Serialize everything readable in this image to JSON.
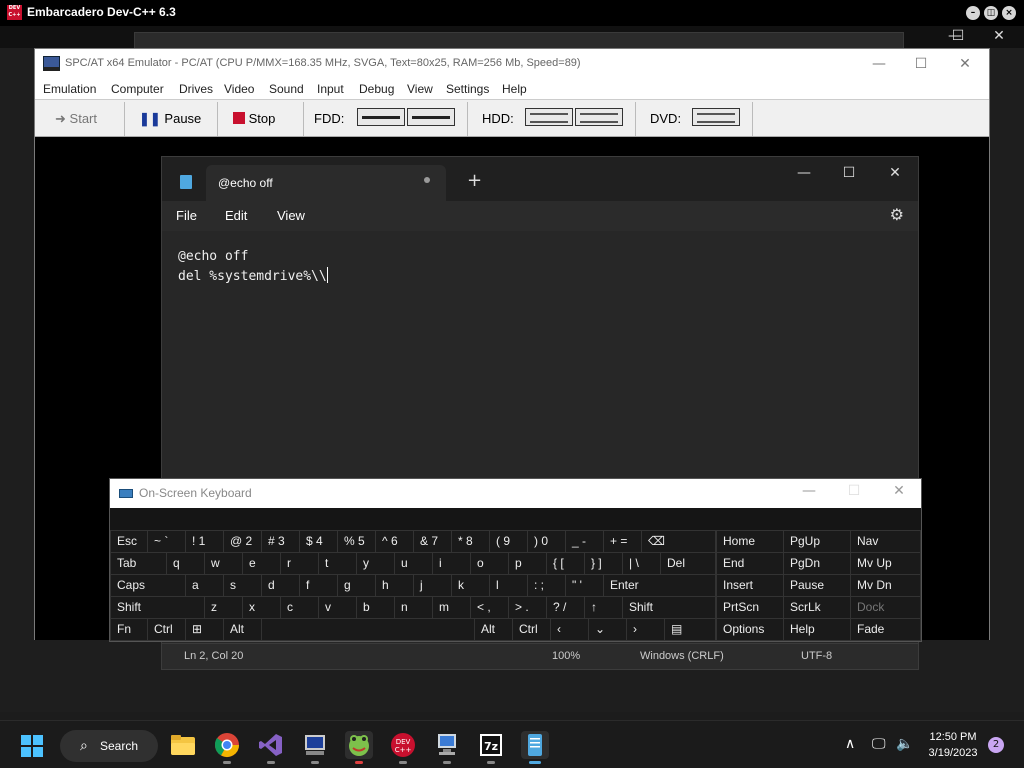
{
  "devcpp": {
    "title": "Embarcadero Dev-C++ 6.3",
    "logo_text": "DEV C++"
  },
  "emulator": {
    "title": "SPC/AT x64 Emulator - PC/AT (CPU P/MMX=168.35 MHz, SVGA, Text=80x25, RAM=256 Mb, Speed=89)",
    "menu": [
      "Emulation",
      "Computer",
      "Drives",
      "Video",
      "Sound",
      "Input",
      "Debug",
      "View",
      "Settings",
      "Help"
    ],
    "toolbar": {
      "start": "Start",
      "pause": "Pause",
      "stop": "Stop",
      "fdd": "FDD:",
      "hdd": "HDD:",
      "dvd": "DVD:"
    },
    "stop_color": "#c8102e",
    "pause_color": "#1a3a9a"
  },
  "notepad": {
    "tab_title": "@echo off",
    "menu": [
      "File",
      "Edit",
      "View"
    ],
    "lines": [
      "@echo off",
      "del %systemdrive%\\\\"
    ],
    "status": {
      "position": "Ln 2, Col 20",
      "zoom": "100%",
      "line_ending": "Windows (CRLF)",
      "encoding": "UTF-8"
    }
  },
  "osk": {
    "title": "On-Screen Keyboard",
    "rows": [
      [
        "Esc",
        "~ `",
        "! 1",
        "@ 2",
        "# 3",
        "$ 4",
        "% 5",
        "^ 6",
        "& 7",
        "* 8",
        "( 9",
        ") 0",
        "_ -",
        "+ =",
        "⌫"
      ],
      [
        "Tab",
        "q",
        "w",
        "e",
        "r",
        "t",
        "y",
        "u",
        "i",
        "o",
        "p",
        "{ [",
        "} ]",
        "| \\",
        "Del"
      ],
      [
        "Caps",
        "a",
        "s",
        "d",
        "f",
        "g",
        "h",
        "j",
        "k",
        "l",
        ": ;",
        "\" '",
        "Enter"
      ],
      [
        "Shift",
        "z",
        "x",
        "c",
        "v",
        "b",
        "n",
        "m",
        "< ,",
        "> .",
        "? /",
        "↑",
        "Shift"
      ],
      [
        "Fn",
        "Ctrl",
        "⊞",
        "Alt",
        "",
        "Alt",
        "Ctrl",
        "‹",
        "⌄",
        "›",
        "▤"
      ]
    ],
    "nav_keys": [
      [
        "Home",
        "PgUp",
        "Nav"
      ],
      [
        "End",
        "PgDn",
        "Mv Up"
      ],
      [
        "Insert",
        "Pause",
        "Mv Dn"
      ],
      [
        "PrtScn",
        "ScrLk",
        "Dock"
      ],
      [
        "Options",
        "Help",
        "Fade"
      ]
    ]
  },
  "taskbar": {
    "search_label": "Search",
    "time": "12:50 PM",
    "date": "3/19/2023",
    "notification_count": "2",
    "apps": [
      "file-explorer",
      "chrome",
      "visual-studio",
      "spc-at-emulator",
      "frog-app",
      "dev-cpp",
      "network-app",
      "7zip",
      "notepad"
    ]
  }
}
